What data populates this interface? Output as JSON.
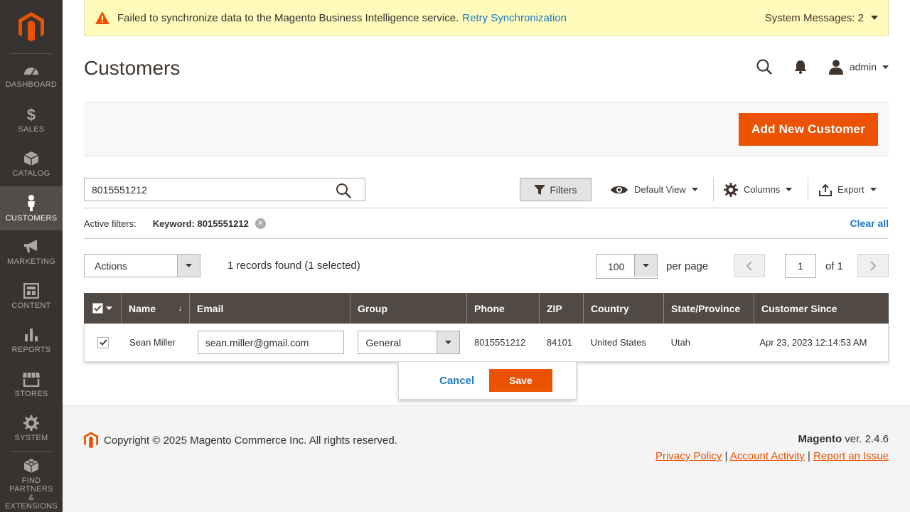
{
  "sidebar": {
    "items": [
      {
        "label": "DASHBOARD",
        "icon": "dashboard-icon"
      },
      {
        "label": "SALES",
        "icon": "dollar-icon"
      },
      {
        "label": "CATALOG",
        "icon": "box-icon"
      },
      {
        "label": "CUSTOMERS",
        "icon": "person-icon",
        "active": true
      },
      {
        "label": "MARKETING",
        "icon": "megaphone-icon"
      },
      {
        "label": "CONTENT",
        "icon": "layout-icon"
      },
      {
        "label": "REPORTS",
        "icon": "bar-chart-icon"
      },
      {
        "label": "STORES",
        "icon": "storefront-icon"
      },
      {
        "label": "SYSTEM",
        "icon": "gear-icon"
      },
      {
        "label_lines": [
          "FIND",
          "PARTNERS",
          "&",
          "EXTENSIONS"
        ],
        "label": "FIND PARTNERS & EXTENSIONS",
        "icon": "cubes-icon"
      }
    ]
  },
  "system_message": {
    "text": "Failed to synchronize data to the Magento Business Intelligence service.",
    "link": "Retry Synchronization",
    "count": "System Messages: 2"
  },
  "header": {
    "title": "Customers",
    "user": "admin"
  },
  "toolbar": {
    "add_button": "Add New Customer"
  },
  "grid_controls": {
    "search_value": "8015551212",
    "filters_label": "Filters",
    "view_label": "Default View",
    "columns_label": "Columns",
    "export_label": "Export",
    "active_filters_label": "Active filters:",
    "active_filter": "Keyword: 8015551212",
    "clear_all": "Clear all",
    "actions_label": "Actions",
    "records": "1 records found (1 selected)",
    "per_page_value": "100",
    "per_page_label": "per page",
    "page_value": "1",
    "page_of": "of 1"
  },
  "table": {
    "columns": [
      "Name",
      "Email",
      "Group",
      "Phone",
      "ZIP",
      "Country",
      "State/Province",
      "Customer Since"
    ],
    "row": {
      "name": "Sean Miller",
      "email": "sean.miller@gmail.com",
      "group": "General",
      "phone": "8015551212",
      "zip": "84101",
      "country": "United States",
      "state": "Utah",
      "since": "Apr 23, 2023 12:14:53 AM"
    },
    "cancel_label": "Cancel",
    "save_label": "Save"
  },
  "footer": {
    "copyright": "Copyright © 2025 Magento Commerce Inc. All rights reserved.",
    "brand": "Magento",
    "version": "ver. 2.4.6",
    "privacy": "Privacy Policy",
    "activity": " Account Activity",
    "report": "Report an Issue"
  },
  "colors": {
    "accent": "#eb5202",
    "sidebar": "#373330",
    "grid_header": "#514943",
    "link": "#1979c3"
  }
}
